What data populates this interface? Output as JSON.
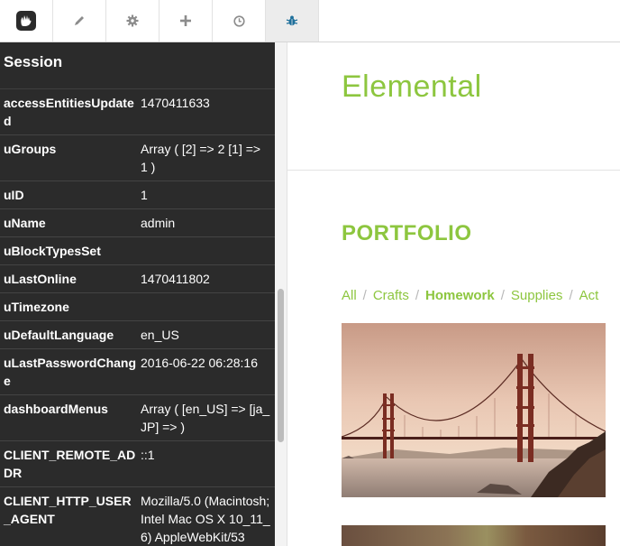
{
  "toolbar": {
    "buttons": [
      {
        "name": "concrete-logo-icon",
        "active": false
      },
      {
        "name": "pencil-icon",
        "active": false
      },
      {
        "name": "gear-icon",
        "active": false
      },
      {
        "name": "plus-icon",
        "active": false
      },
      {
        "name": "clock-icon",
        "active": false
      },
      {
        "name": "bug-icon",
        "active": true
      }
    ]
  },
  "sidebar": {
    "title": "Session",
    "rows": [
      {
        "key": "accessEntitiesUpdated",
        "value": "1470411633"
      },
      {
        "key": "uGroups",
        "value": "Array ( [2] => 2 [1] => 1 )"
      },
      {
        "key": "uID",
        "value": "1"
      },
      {
        "key": "uName",
        "value": "admin"
      },
      {
        "key": "uBlockTypesSet",
        "value": ""
      },
      {
        "key": "uLastOnline",
        "value": "1470411802"
      },
      {
        "key": "uTimezone",
        "value": ""
      },
      {
        "key": "uDefaultLanguage",
        "value": "en_US"
      },
      {
        "key": "uLastPasswordChange",
        "value": "2016-06-22 06:28:16"
      },
      {
        "key": "dashboardMenus",
        "value": "Array ( [en_US] => [ja_JP] => )"
      },
      {
        "key": "CLIENT_REMOTE_ADDR",
        "value": "::1"
      },
      {
        "key": "CLIENT_HTTP_USER_AGENT",
        "value": "Mozilla/5.0 (Macintosh; Intel Mac OS X 10_11_6) AppleWebKit/53"
      }
    ]
  },
  "main": {
    "brand": "Elemental",
    "section_title": "PORTFOLIO",
    "filters": [
      "All",
      "Crafts",
      "Homework",
      "Supplies",
      "Act"
    ],
    "active_filter": "Homework"
  },
  "colors": {
    "accent": "#8dc63f",
    "sidebar_bg": "#2b2b2b"
  }
}
